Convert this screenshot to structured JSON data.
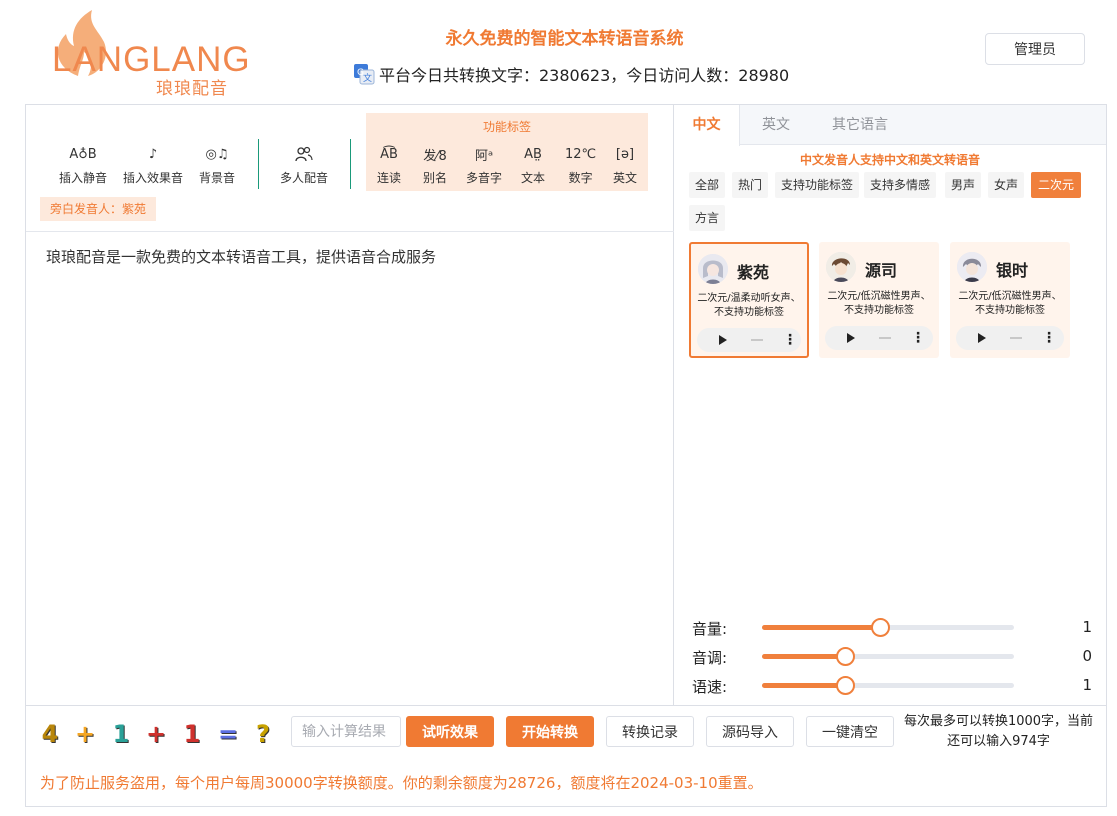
{
  "header": {
    "logo_text": "LANGLANG",
    "logo_sub": "琅琅配音",
    "title": "永久免费的智能文本转语音系统",
    "stats": "平台今日共转换文字：2380623，今日访问人数：28980",
    "admin_button": "管理员"
  },
  "toolbar": {
    "tools": [
      {
        "icon": "insert-silence-icon",
        "glyph": "A♁B",
        "label": "插入静音"
      },
      {
        "icon": "insert-effect-icon",
        "glyph": "♪",
        "label": "插入效果音"
      },
      {
        "icon": "background-music-icon",
        "glyph": "◎♫",
        "label": "背景音"
      },
      {
        "icon": "multi-speaker-icon",
        "glyph": "👥",
        "label": "多人配音"
      }
    ],
    "function_tags_title": "功能标签",
    "function_tags": [
      {
        "icon": "liaison-icon",
        "glyph": "A͡B",
        "label": "连读"
      },
      {
        "icon": "alias-icon",
        "glyph": "发⁄8",
        "label": "别名"
      },
      {
        "icon": "polyphone-icon",
        "glyph": "阿ᵃ",
        "label": "多音字"
      },
      {
        "icon": "text-icon",
        "glyph": "AB̤",
        "label": "文本"
      },
      {
        "icon": "number-icon",
        "glyph": "12℃",
        "label": "数字"
      },
      {
        "icon": "english-icon",
        "glyph": "[ə]",
        "label": "英文"
      }
    ],
    "narrator": "旁白发音人：紫苑"
  },
  "editor": {
    "text": "琅琅配音是一款免费的文本转语音工具，提供语音合成服务"
  },
  "language_tabs": [
    "中文",
    "英文",
    "其它语言"
  ],
  "voice_note": "中文发音人支持中文和英文转语音",
  "categories": [
    "全部",
    "热门",
    "支持功能标签",
    "支持多情感",
    "男声",
    "女声",
    "二次元",
    "方言"
  ],
  "active_category": "二次元",
  "voices": [
    {
      "name": "紫苑",
      "desc1": "二次元/温柔动听女声、",
      "desc2": "不支持功能标签"
    },
    {
      "name": "源司",
      "desc1": "二次元/低沉磁性男声、",
      "desc2": "不支持功能标签"
    },
    {
      "name": "银时",
      "desc1": "二次元/低沉磁性男声、",
      "desc2": "不支持功能标签"
    }
  ],
  "sliders": [
    {
      "label": "音量:",
      "value": "1",
      "level": 0.47
    },
    {
      "label": "音调:",
      "value": "0",
      "level": 0.33
    },
    {
      "label": "语速:",
      "value": "1",
      "level": 0.33
    }
  ],
  "bottom": {
    "calc_symbols": [
      {
        "glyph": "4",
        "color": "#b8860b"
      },
      {
        "glyph": "+",
        "color": "#f5a623"
      },
      {
        "glyph": "1",
        "color": "#2aa198"
      },
      {
        "glyph": "+",
        "color": "#d0312d"
      },
      {
        "glyph": "1",
        "color": "#d0312d"
      },
      {
        "glyph": "=",
        "color": "#5b6ee1"
      },
      {
        "glyph": "?",
        "color": "#c8a200"
      }
    ],
    "calc_placeholder": "输入计算结果",
    "preview_button": "试听效果",
    "convert_button": "开始转换",
    "history_button": "转换记录",
    "import_button": "源码导入",
    "clear_button": "一键清空",
    "limit_note": "每次最多可以转换1000字，当前还可以输入974字",
    "quota": "为了防止服务盗用，每个用户每周30000字转换额度。你的剩余额度为28726，额度将在2024-03-10重置。"
  },
  "colors": {
    "accent": "#f07a33",
    "accent_light": "#fde9dc",
    "divider": "#1a9a7a"
  }
}
